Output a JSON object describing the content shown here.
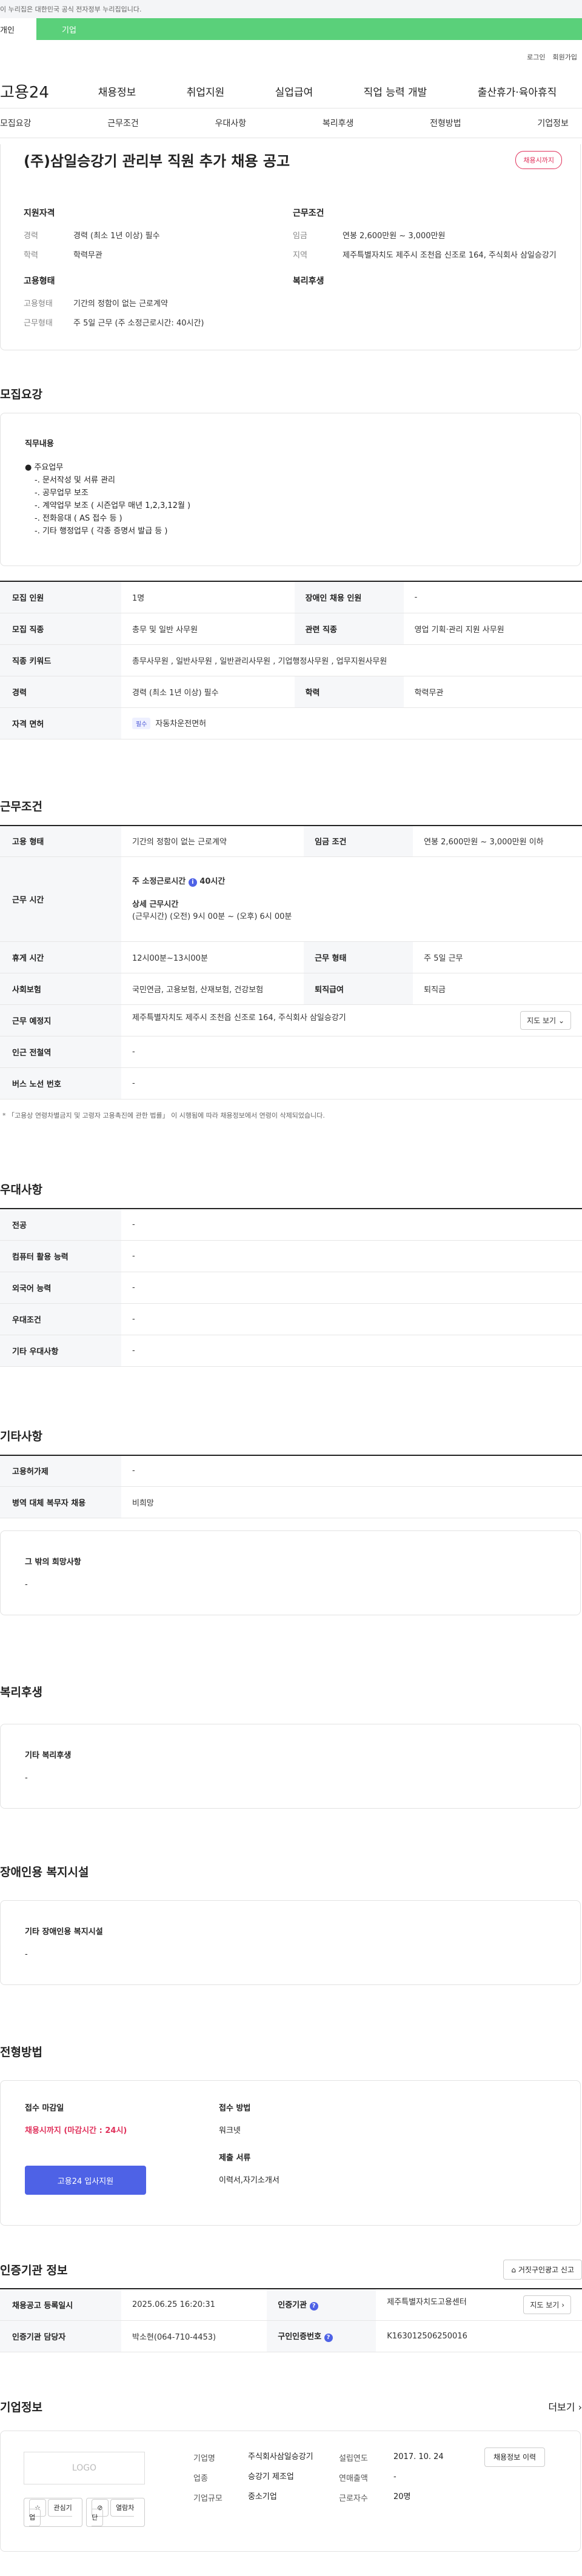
{
  "topbar": "이 누리집은 대한민국 공식 전자정부 누리집입니다.",
  "usertype": {
    "individual": "개인",
    "corporate": "기업"
  },
  "util": {
    "login": "로그인",
    "signup": "회원가입"
  },
  "gnb": {
    "logo": "고용24",
    "menu": [
      "채용정보",
      "취업지원",
      "실업급여",
      "직업 능력 개발",
      "출산휴가·육아휴직"
    ]
  },
  "subtabs": [
    "모집요강",
    "근무조건",
    "우대사항",
    "복리후생",
    "전형방법",
    "기업정보"
  ],
  "summary": {
    "title": "(주)삼일승강기 관리부 직원 추가 채용 공고",
    "status": "채용시까지",
    "qual_title": "지원자격",
    "qual": [
      {
        "k": "경력",
        "v": "경력 (최소 1년 이상) 필수"
      },
      {
        "k": "학력",
        "v": "학력무관"
      }
    ],
    "cond_title": "근무조건",
    "cond": [
      {
        "k": "임금",
        "v": "연봉 2,600만원 ~ 3,000만원"
      },
      {
        "k": "지역",
        "v": "제주특별자치도 제주시 조천읍 신조로 164, 주식회사 삼일승강기"
      }
    ],
    "emp_title": "고용형태",
    "emp": [
      {
        "k": "고용형태",
        "v": "기간의 정함이 없는 근로계약"
      },
      {
        "k": "근무형태",
        "v": "주 5일 근무 (주 소정근로시간: 40시간)"
      }
    ],
    "welfare_title": "복리후생"
  },
  "recruit": {
    "title": "모집요강",
    "duty_label": "직무내용",
    "duty_lines": [
      "● 주요업무",
      "  -. 문서작성 및 서류 관리",
      "  -. 공무업무 보조",
      "  -. 계약업무 보조 ( 시즌업무 매년 1,2,3,12월 )",
      "  -. 전화응대 ( AS 접수 등 )",
      "  -. 기타 행정업무 ( 각종 증명서 발급 등 )"
    ],
    "rows": [
      {
        "k1": "모집 인원",
        "v1": "1명",
        "k2": "장애인 채용 인원",
        "v2": "-"
      },
      {
        "k1": "모집 직종",
        "v1": "총무 및 일반 사무원",
        "k2": "관련 직종",
        "v2": "영업 기획·관리 지원 사무원"
      },
      {
        "k1": "직종 키워드",
        "v1": "총무사무원 , 일반사무원 , 일반관리사무원 , 기업행정사무원 , 업무지원사무원"
      },
      {
        "k1": "경력",
        "v1": "경력 (최소 1년 이상) 필수",
        "k2": "학력",
        "v2": "학력무관"
      },
      {
        "k1": "자격 면허",
        "tag": "필수",
        "v1": "자동차운전면허"
      }
    ]
  },
  "work": {
    "title": "근무조건",
    "emp_k": "고용 형태",
    "emp_v": "기간의 정함이 없는 근로계약",
    "wage_k": "임금 조건",
    "wage_v": "연봉 2,600만원 ~ 3,000만원 이하",
    "time_k": "근무 시간",
    "time_a": "주 소정근로시간",
    "time_a_v": "40시간",
    "time_b": "상세 근무시간",
    "time_b_v": "(근무시간) (오전) 9시 00분 ~ (오후) 6시 00분",
    "rest_k": "휴게 시간",
    "rest_v": "12시00분~13시00분",
    "form_k": "근무 형태",
    "form_v": "주 5일 근무",
    "ins_k": "사회보험",
    "ins_v": "국민연금, 고용보험, 산재보험, 건강보험",
    "sev_k": "퇴직급여",
    "sev_v": "퇴직금",
    "place_k": "근무 예정지",
    "place_v": "제주특별자치도 제주시 조천읍 신조로 164, 주식회사 삼일승강기",
    "map": "지도 보기",
    "subway_k": "인근 전철역",
    "subway_v": "-",
    "bus_k": "버스 노선 번호",
    "bus_v": "-",
    "note": "* 「고용상 연령차별금지 및 고령자 고용촉진에 관한 법률」 이 시행됨에 따라 채용정보에서 연령이 삭제되었습니다."
  },
  "pref": {
    "title": "우대사항",
    "rows": [
      {
        "k": "전공",
        "v": "-"
      },
      {
        "k": "컴퓨터 활용 능력",
        "v": "-"
      },
      {
        "k": "외국어 능력",
        "v": "-"
      },
      {
        "k": "우대조건",
        "v": "-"
      },
      {
        "k": "기타 우대사항",
        "v": "-"
      }
    ]
  },
  "other": {
    "title": "기타사항",
    "rows": [
      {
        "k": "고용허가제",
        "v": "-"
      },
      {
        "k": "병역 대체 복무자 채용",
        "v": "비희망"
      }
    ],
    "extra_label": "그 밖의 희망사항",
    "extra_v": "-"
  },
  "welfare": {
    "title": "복리후생",
    "label": "기타 복리후생",
    "v": "-"
  },
  "disabled": {
    "title": "장애인용 복지시설",
    "label": "기타 장애인용 복지시설",
    "v": "-"
  },
  "selection": {
    "title": "전형방법",
    "deadline_label": "접수 마감일",
    "deadline_v": "채용시까지 (마감시간 : 24시)",
    "apply_btn": "고용24 입사지원",
    "method_label": "접수 방법",
    "method_v": "워크넷",
    "docs_label": "제출 서류",
    "docs_v": "이력서,자기소개서"
  },
  "cert": {
    "title": "인증기관 정보",
    "report": "거짓구인광고 신고",
    "rows": [
      {
        "k1": "채용공고 등록일시",
        "v1": "2025.06.25 16:20:31",
        "k2": "인증기관",
        "v2": "제주특별자치도고용센터",
        "btn": "지도 보기"
      },
      {
        "k1": "인증기관 담당자",
        "v1": "박소현(064-710-4453)",
        "k2": "구인인증번호",
        "v2": "K163012506250016"
      }
    ]
  },
  "company": {
    "title": "기업정보",
    "more": "더보기",
    "logo": "LOGO",
    "fav": "관심기업",
    "block": "열람차단",
    "col1": [
      {
        "k": "기업명",
        "v": "주식회사삼일승강기"
      },
      {
        "k": "업종",
        "v": "승강기 제조업"
      },
      {
        "k": "기업규모",
        "v": "중소기업"
      }
    ],
    "col2": [
      {
        "k": "설립연도",
        "v": "2017. 10. 24"
      },
      {
        "k": "연매출액",
        "v": "-"
      },
      {
        "k": "근로자수",
        "v": "20명"
      }
    ],
    "history_btn": "채용정보 이력"
  }
}
